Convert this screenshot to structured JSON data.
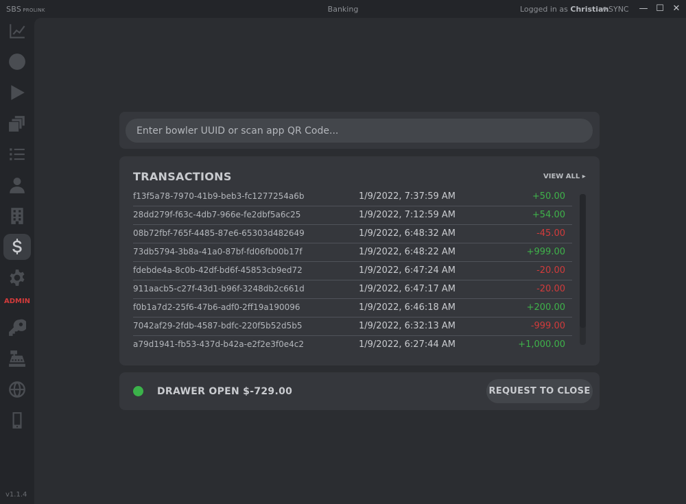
{
  "titlebar": {
    "brand": "SBS",
    "brand_sub": "PROLINK",
    "window_title": "Banking",
    "login_prefix": "Logged in as",
    "username": "Christian",
    "sync_label": "SYNC",
    "minimize": "—",
    "maximize": "☐",
    "close": "✕"
  },
  "sidebar": {
    "items": [
      {
        "icon": "chart-icon"
      },
      {
        "icon": "clock-icon"
      },
      {
        "icon": "play-icon"
      },
      {
        "icon": "cards-icon"
      },
      {
        "icon": "list-icon"
      },
      {
        "icon": "user-icon"
      },
      {
        "icon": "building-icon"
      },
      {
        "icon": "dollar-icon",
        "active": true
      },
      {
        "icon": "gear-icon"
      },
      {
        "icon": "key-icon"
      },
      {
        "icon": "register-icon"
      },
      {
        "icon": "globe-icon"
      },
      {
        "icon": "phone-icon"
      }
    ],
    "admin_label": "ADMIN",
    "version": "v1.1.4"
  },
  "search": {
    "placeholder": "Enter bowler UUID or scan app QR Code..."
  },
  "transactions": {
    "title": "TRANSACTIONS",
    "view_all": "VIEW ALL ▸",
    "rows": [
      {
        "id": "f13f5a78-7970-41b9-beb3-fc1277254a6b",
        "date": "1/9/2022, 7:37:59 AM",
        "amount": "+50.00",
        "sign": "pos"
      },
      {
        "id": "28dd279f-f63c-4db7-966e-fe2dbf5a6c25",
        "date": "1/9/2022, 7:12:59 AM",
        "amount": "+54.00",
        "sign": "pos"
      },
      {
        "id": "08b72fbf-765f-4485-87e6-65303d482649",
        "date": "1/9/2022, 6:48:32 AM",
        "amount": "-45.00",
        "sign": "neg"
      },
      {
        "id": "73db5794-3b8a-41a0-87bf-fd06fb00b17f",
        "date": "1/9/2022, 6:48:22 AM",
        "amount": "+999.00",
        "sign": "pos"
      },
      {
        "id": "fdebde4a-8c0b-42df-bd6f-45853cb9ed72",
        "date": "1/9/2022, 6:47:24 AM",
        "amount": "-20.00",
        "sign": "neg"
      },
      {
        "id": "911aacb5-c27f-43d1-b96f-3248db2c661d",
        "date": "1/9/2022, 6:47:17 AM",
        "amount": "-20.00",
        "sign": "neg"
      },
      {
        "id": "f0b1a7d2-25f6-47b6-adf0-2ff19a190096",
        "date": "1/9/2022, 6:46:18 AM",
        "amount": "+200.00",
        "sign": "pos"
      },
      {
        "id": "7042af29-2fdb-4587-bdfc-220f5b52d5b5",
        "date": "1/9/2022, 6:32:13 AM",
        "amount": "-999.00",
        "sign": "neg"
      },
      {
        "id": "a79d1941-fb53-437d-b42a-e2f2e3f0e4c2",
        "date": "1/9/2022, 6:27:44 AM",
        "amount": "+1,000.00",
        "sign": "pos"
      }
    ]
  },
  "drawer": {
    "status": "DRAWER OPEN $-729.00",
    "status_color": "#3bb24a",
    "close_label": "REQUEST TO CLOSE"
  },
  "colors": {
    "positive": "#3fb24a",
    "negative": "#d23b3b",
    "admin": "#d23b3b"
  }
}
